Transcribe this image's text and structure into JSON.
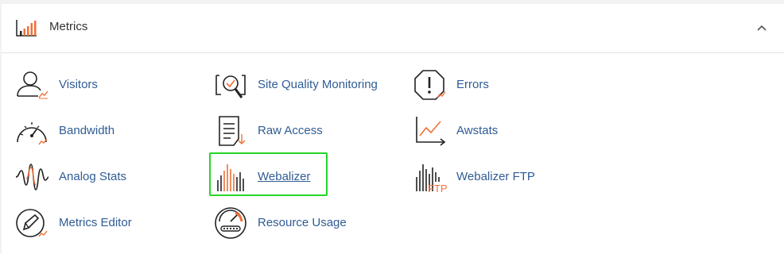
{
  "section": {
    "title": "Metrics",
    "header_icon": "bar-chart-icon",
    "collapse_icon": "chevron-up-icon"
  },
  "items": [
    {
      "label": "Visitors",
      "icon": "visitors-icon"
    },
    {
      "label": "Site Quality Monitoring",
      "icon": "site-quality-icon"
    },
    {
      "label": "Errors",
      "icon": "errors-icon"
    },
    {
      "label": "Bandwidth",
      "icon": "bandwidth-icon"
    },
    {
      "label": "Raw Access",
      "icon": "raw-access-icon"
    },
    {
      "label": "Awstats",
      "icon": "awstats-icon"
    },
    {
      "label": "Analog Stats",
      "icon": "analog-stats-icon"
    },
    {
      "label": "Webalizer",
      "icon": "webalizer-icon"
    },
    {
      "label": "Webalizer FTP",
      "icon": "webalizer-ftp-icon",
      "icon_text": "FTP"
    },
    {
      "label": "Metrics Editor",
      "icon": "metrics-editor-icon"
    },
    {
      "label": "Resource Usage",
      "icon": "resource-usage-icon"
    }
  ],
  "colors": {
    "link": "#2f5c95",
    "accent": "#f07138",
    "highlight": "#26d626"
  }
}
